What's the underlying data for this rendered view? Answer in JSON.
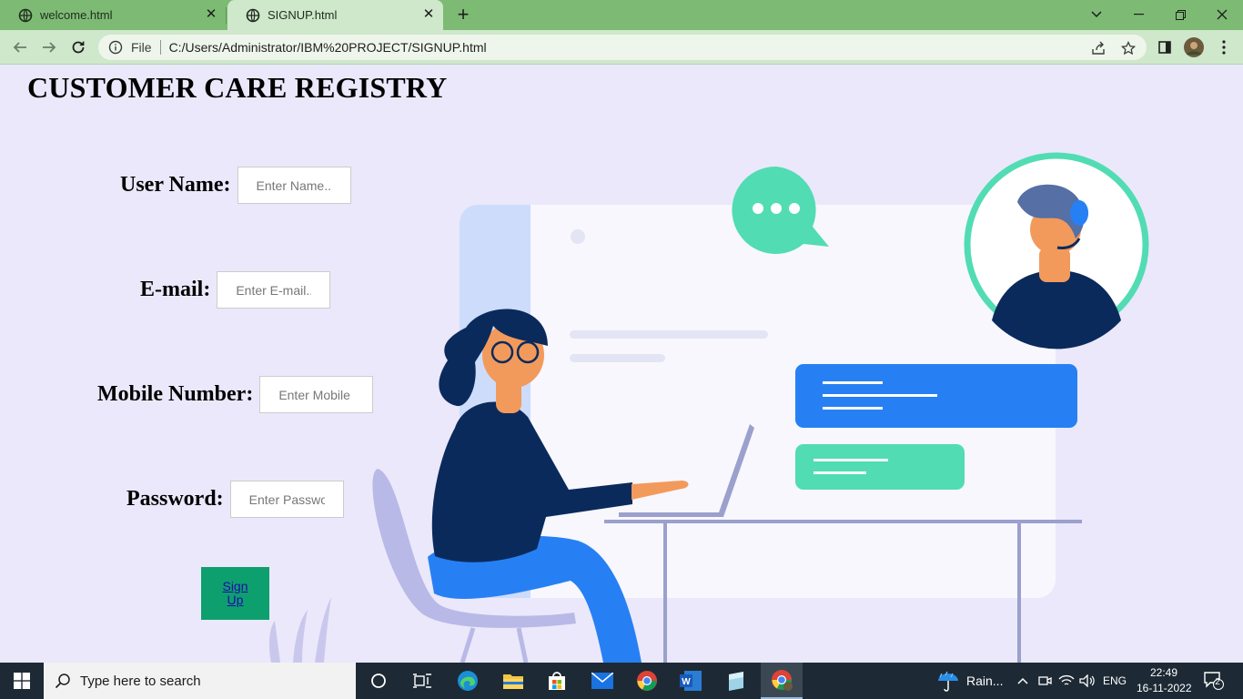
{
  "browser": {
    "tabs": [
      {
        "title": "welcome.html",
        "active": false
      },
      {
        "title": "SIGNUP.html",
        "active": true
      }
    ],
    "new_tab_label": "+",
    "address_scheme": "File",
    "address_url": "C:/Users/Administrator/IBM%20PROJECT/SIGNUP.html",
    "accent_color": "#7dbb74"
  },
  "page": {
    "title": "CUSTOMER CARE REGISTRY",
    "form": {
      "username_label": "User Name:",
      "username_placeholder": "Enter Name...",
      "email_label": "E-mail:",
      "email_placeholder": "Enter E-mail...",
      "mobile_label": "Mobile Number:",
      "mobile_placeholder": "Enter Mobile Number",
      "password_label": "Password:",
      "password_placeholder": "Enter Password",
      "signup_label": "Sign Up"
    },
    "background_color": "#ebe8fb",
    "button_color": "#0e9f6e"
  },
  "taskbar": {
    "search_placeholder": "Type here to search",
    "weather": "Rain...",
    "language": "ENG",
    "time": "22:49",
    "date": "16-11-2022",
    "notification_count": "2",
    "pinned_icons": [
      "cortana-icon",
      "task-view-icon",
      "edge-icon",
      "file-explorer-icon",
      "store-icon",
      "mail-icon",
      "chrome-icon",
      "word-icon",
      "app-icon",
      "chrome-active-icon"
    ]
  }
}
